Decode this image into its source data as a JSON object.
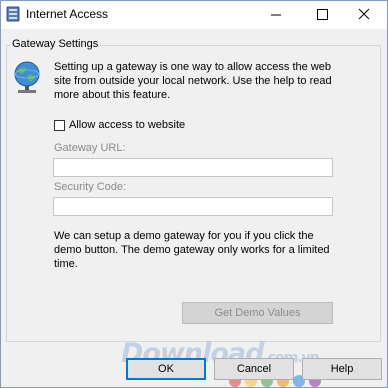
{
  "window": {
    "title": "Internet Access"
  },
  "group": {
    "label": "Gateway Settings"
  },
  "intro_text": "Setting up a gateway is one way to allow access the web site from outside your local network. Use the help to read more about this feature.",
  "allow_access": {
    "label": "Allow access to website",
    "checked": false
  },
  "gateway_url": {
    "label": "Gateway URL:",
    "value": ""
  },
  "security_code": {
    "label": "Security Code:",
    "value": ""
  },
  "demo_note": "We can setup a demo gateway for you if you click the demo button. The demo gateway only works for a limited time.",
  "buttons": {
    "demo": "Get Demo Values",
    "ok": "OK",
    "cancel": "Cancel",
    "help": "Help"
  },
  "watermark": {
    "text": "Download",
    "suffix": ".com.vn"
  },
  "colors": {
    "dot_colors": [
      "#e53935",
      "#fbc02d",
      "#43a047",
      "#fb8c00",
      "#1e88e5",
      "#8e24aa"
    ],
    "accent": "#0078d7"
  }
}
